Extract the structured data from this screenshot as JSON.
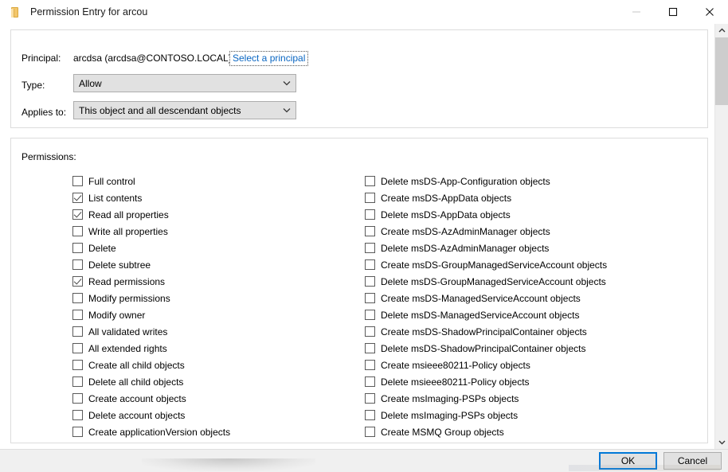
{
  "window": {
    "title": "Permission Entry for arcou",
    "icon": "folder-icon",
    "controls": {
      "minimize": "minimize-icon",
      "maximize": "maximize-icon",
      "close": "close-icon"
    }
  },
  "principal_section": {
    "principal_label": "Principal:",
    "principal_value": "arcdsa (arcdsa@CONTOSO.LOCAL)",
    "select_principal_link": "Select a principal",
    "type_label": "Type:",
    "type_value": "Allow",
    "applies_to_label": "Applies to:",
    "applies_to_value": "This object and all descendant objects"
  },
  "permissions_section": {
    "label": "Permissions:",
    "left_column": [
      {
        "label": "Full control",
        "checked": false
      },
      {
        "label": "List contents",
        "checked": true
      },
      {
        "label": "Read all properties",
        "checked": true
      },
      {
        "label": "Write all properties",
        "checked": false
      },
      {
        "label": "Delete",
        "checked": false
      },
      {
        "label": "Delete subtree",
        "checked": false
      },
      {
        "label": "Read permissions",
        "checked": true
      },
      {
        "label": "Modify permissions",
        "checked": false
      },
      {
        "label": "Modify owner",
        "checked": false
      },
      {
        "label": "All validated writes",
        "checked": false
      },
      {
        "label": "All extended rights",
        "checked": false
      },
      {
        "label": "Create all child objects",
        "checked": false
      },
      {
        "label": "Delete all child objects",
        "checked": false
      },
      {
        "label": "Create account objects",
        "checked": false
      },
      {
        "label": "Delete account objects",
        "checked": false
      },
      {
        "label": "Create applicationVersion objects",
        "checked": false
      }
    ],
    "right_column": [
      {
        "label": "Delete msDS-App-Configuration objects",
        "checked": false
      },
      {
        "label": "Create msDS-AppData objects",
        "checked": false
      },
      {
        "label": "Delete msDS-AppData objects",
        "checked": false
      },
      {
        "label": "Create msDS-AzAdminManager objects",
        "checked": false
      },
      {
        "label": "Delete msDS-AzAdminManager objects",
        "checked": false
      },
      {
        "label": "Create msDS-GroupManagedServiceAccount objects",
        "checked": false
      },
      {
        "label": "Delete msDS-GroupManagedServiceAccount objects",
        "checked": false
      },
      {
        "label": "Create msDS-ManagedServiceAccount objects",
        "checked": false
      },
      {
        "label": "Delete msDS-ManagedServiceAccount objects",
        "checked": false
      },
      {
        "label": "Create msDS-ShadowPrincipalContainer objects",
        "checked": false
      },
      {
        "label": "Delete msDS-ShadowPrincipalContainer objects",
        "checked": false
      },
      {
        "label": "Create msieee80211-Policy objects",
        "checked": false
      },
      {
        "label": "Delete msieee80211-Policy objects",
        "checked": false
      },
      {
        "label": "Create msImaging-PSPs objects",
        "checked": false
      },
      {
        "label": "Delete msImaging-PSPs objects",
        "checked": false
      },
      {
        "label": "Create MSMQ Group objects",
        "checked": false
      }
    ]
  },
  "footer": {
    "ok_label": "OK",
    "cancel_label": "Cancel"
  },
  "scrollbar": {
    "up_arrow": "chevron-up-icon",
    "down_arrow": "chevron-down-icon"
  },
  "colors": {
    "accent": "#0078d7",
    "link": "#0a66c2",
    "window_bg": "#ffffff",
    "footer_bg": "#f0f0f0",
    "control_bg": "#e1e1e1",
    "control_border": "#adadad",
    "group_border": "#dcdcdc"
  }
}
